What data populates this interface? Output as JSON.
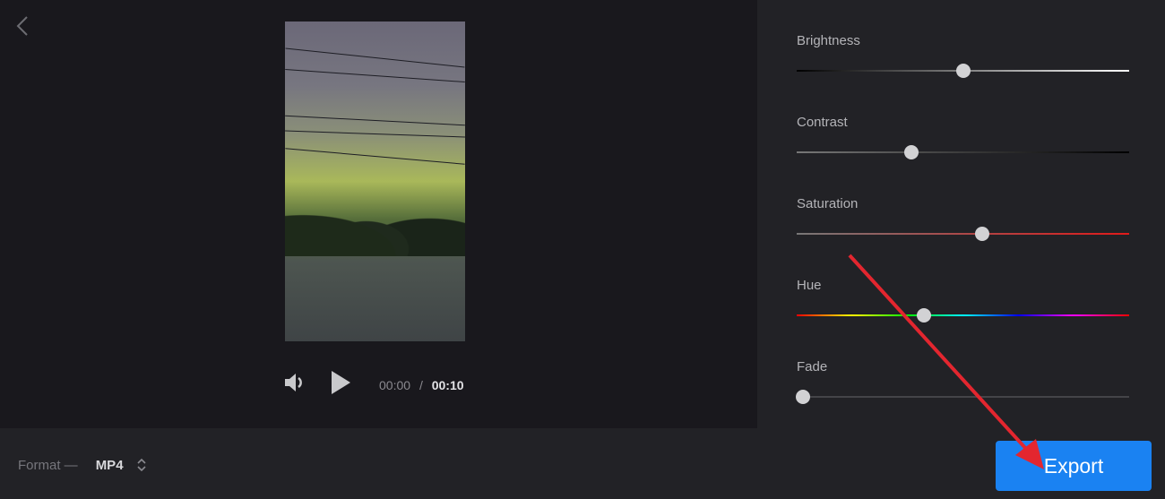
{
  "player": {
    "current_time": "00:00",
    "separator": "/",
    "duration": "00:10"
  },
  "adjustments": [
    {
      "label": "Brightness",
      "value": 0.5
    },
    {
      "label": "Contrast",
      "value": 0.345
    },
    {
      "label": "Saturation",
      "value": 0.557
    },
    {
      "label": "Hue",
      "value": 0.384
    },
    {
      "label": "Fade",
      "value": 0.02
    }
  ],
  "footer": {
    "format_label": "Format —",
    "format_value": "MP4",
    "export_label": "Export"
  },
  "colors": {
    "accent": "#1a82f2",
    "annotation_arrow": "#e3262f"
  }
}
